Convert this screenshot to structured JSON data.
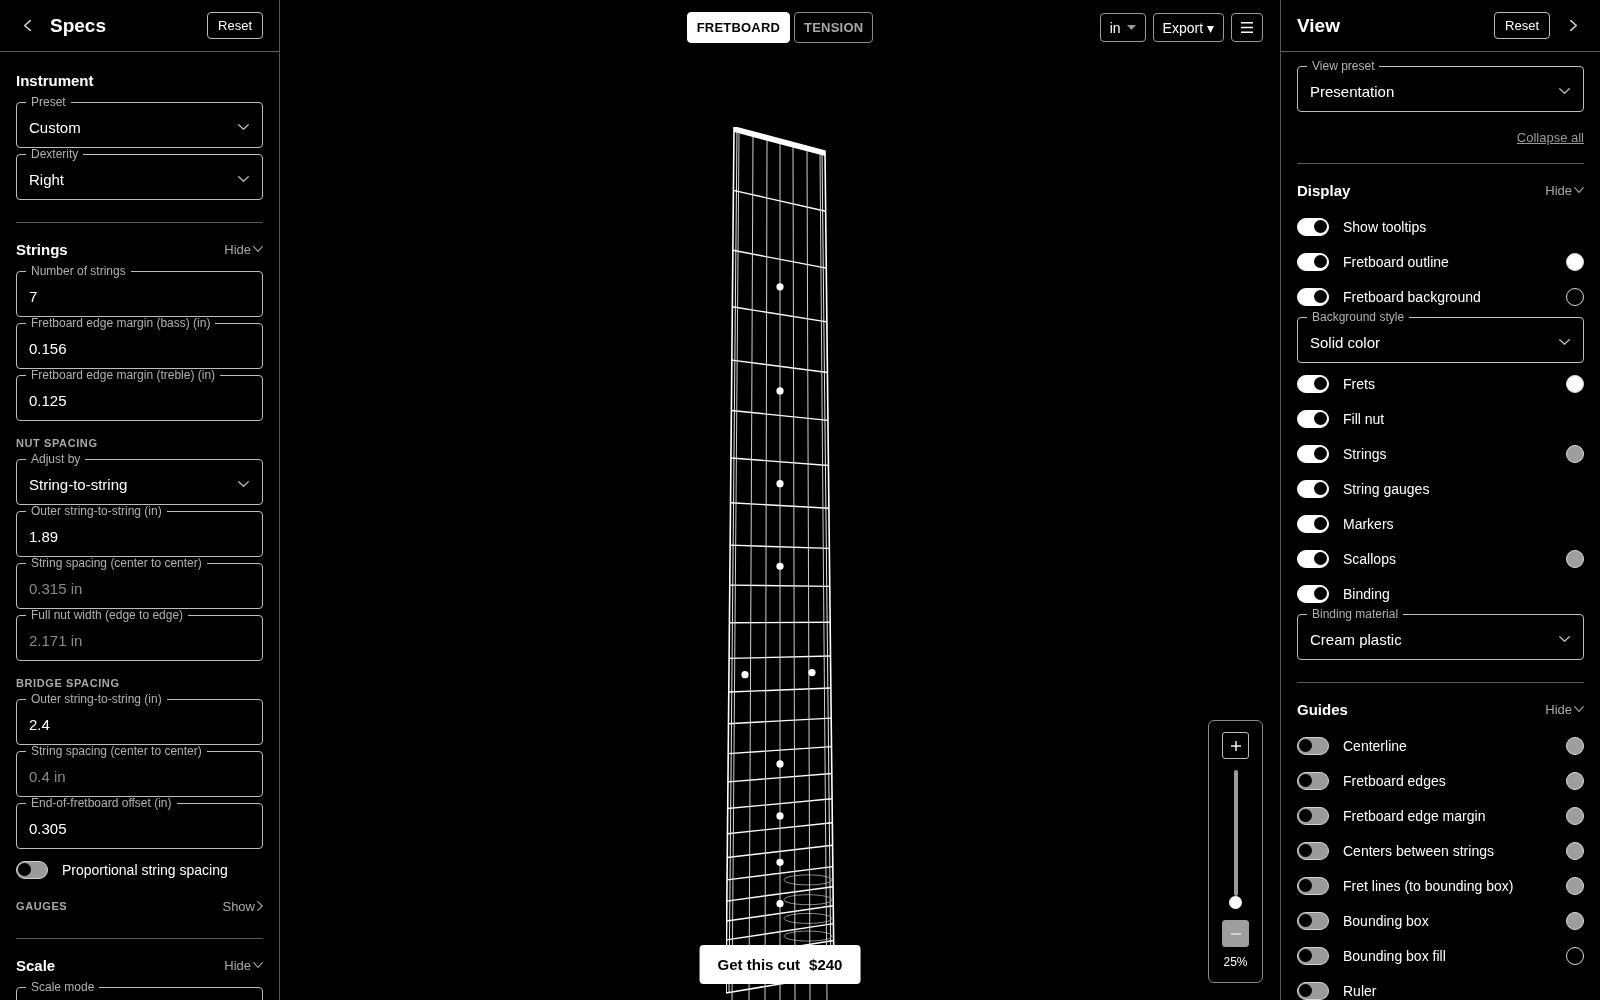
{
  "left_panel": {
    "title": "Specs",
    "reset_button": "Reset",
    "sections": [
      {
        "title": "Instrument",
        "items": [
          {
            "kind": "select",
            "label": "Preset",
            "value": "Custom"
          },
          {
            "kind": "select",
            "label": "Dexterity",
            "value": "Right"
          }
        ]
      },
      {
        "title": "Strings",
        "toggle": {
          "label": "Hide",
          "expanded": true
        },
        "items": [
          {
            "kind": "number",
            "label": "Number of strings",
            "value": "7",
            "disabled": false
          },
          {
            "kind": "number",
            "label": "Fretboard edge margin (bass) (in)",
            "value": "0.156",
            "disabled": false
          },
          {
            "kind": "number",
            "label": "Fretboard edge margin (treble) (in)",
            "value": "0.125",
            "disabled": false
          },
          {
            "kind": "group",
            "title": "NUT SPACING",
            "items": [
              {
                "kind": "select",
                "label": "Adjust by",
                "value": "String-to-string"
              },
              {
                "kind": "number",
                "label": "Outer string-to-string (in)",
                "value": "1.89",
                "disabled": false
              },
              {
                "kind": "number",
                "label": "String spacing (center to center)",
                "value": "0.315 in",
                "disabled": true
              },
              {
                "kind": "number",
                "label": "Full nut width (edge to edge)",
                "value": "2.171 in",
                "disabled": true
              }
            ]
          },
          {
            "kind": "group",
            "title": "BRIDGE SPACING",
            "items": [
              {
                "kind": "number",
                "label": "Outer string-to-string (in)",
                "value": "2.4",
                "disabled": false
              },
              {
                "kind": "number",
                "label": "String spacing (center to center)",
                "value": "0.4 in",
                "disabled": true
              },
              {
                "kind": "number",
                "label": "End-of-fretboard offset (in)",
                "value": "0.305",
                "disabled": false
              }
            ]
          },
          {
            "kind": "switch",
            "label": "Proportional string spacing",
            "on": false
          },
          {
            "kind": "group",
            "title": "GAUGES",
            "toggle": {
              "label": "Show",
              "expanded": false
            }
          }
        ]
      },
      {
        "title": "Scale",
        "toggle": {
          "label": "Hide",
          "expanded": true
        },
        "items": [
          {
            "kind": "select",
            "label": "Scale mode"
          }
        ]
      }
    ]
  },
  "center": {
    "tabs": [
      {
        "label": "FRETBOARD",
        "selected": true
      },
      {
        "label": "TENSION",
        "selected": false
      }
    ],
    "unit_dropdown": "in",
    "export_button": "Export ▾",
    "zoom": {
      "zoom_in": {
        "disabled": false
      },
      "level": 0,
      "zoom_out": {
        "disabled": true
      },
      "reading": "25%"
    },
    "cta": {
      "label": "Get this cut",
      "price": "$240"
    }
  },
  "right_panel": {
    "title": "View",
    "reset_button": "Reset",
    "view_preset": {
      "kind": "select",
      "label": "View preset",
      "value": "Presentation"
    },
    "collapse_all": "Collapse all",
    "sections": [
      {
        "title": "Display",
        "toggle": {
          "label": "Hide",
          "expanded": true
        },
        "items": [
          {
            "kind": "switch",
            "label": "Show tooltips",
            "on": true
          },
          {
            "kind": "switch",
            "label": "Fretboard outline",
            "on": true,
            "color": "#ffffff"
          },
          {
            "kind": "switch",
            "label": "Fretboard background",
            "on": true,
            "color": "#000000"
          },
          {
            "kind": "select",
            "label": "Background style",
            "value": "Solid color"
          },
          {
            "kind": "switch",
            "label": "Frets",
            "on": true,
            "color": "#ffffff"
          },
          {
            "kind": "switch",
            "label": "Fill nut",
            "on": true
          },
          {
            "kind": "switch",
            "label": "Strings",
            "on": true,
            "color": "#9e9e9e"
          },
          {
            "kind": "switch",
            "label": "String gauges",
            "on": true
          },
          {
            "kind": "switch",
            "label": "Markers",
            "on": true
          },
          {
            "kind": "switch",
            "label": "Scallops",
            "on": true,
            "color": "#9e9e9e"
          },
          {
            "kind": "switch",
            "label": "Binding",
            "on": true
          },
          {
            "kind": "select",
            "label": "Binding material",
            "value": "Cream plastic"
          }
        ]
      },
      {
        "title": "Guides",
        "toggle": {
          "label": "Hide",
          "expanded": true
        },
        "items": [
          {
            "kind": "switch",
            "label": "Centerline",
            "on": false,
            "color": "#9e9e9e"
          },
          {
            "kind": "switch",
            "label": "Fretboard edges",
            "on": false,
            "color": "#9e9e9e"
          },
          {
            "kind": "switch",
            "label": "Fretboard edge margin",
            "on": false,
            "color": "#9e9e9e"
          },
          {
            "kind": "switch",
            "label": "Centers between strings",
            "on": false,
            "color": "#9e9e9e"
          },
          {
            "kind": "switch",
            "label": "Fret lines (to bounding box)",
            "on": false,
            "color": "#9e9e9e"
          },
          {
            "kind": "switch",
            "label": "Bounding box",
            "on": false,
            "color": "#9e9e9e"
          },
          {
            "kind": "switch",
            "label": "Bounding box fill",
            "on": false,
            "color": "#000000"
          },
          {
            "kind": "switch",
            "label": "Ruler",
            "on": false
          }
        ]
      }
    ]
  }
}
